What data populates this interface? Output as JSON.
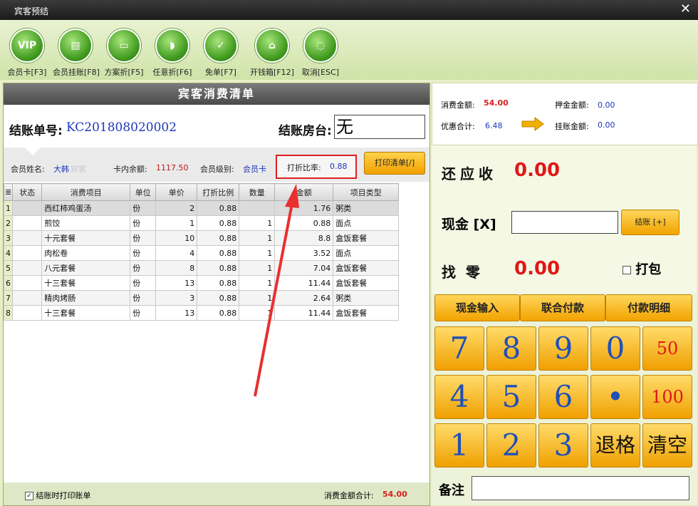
{
  "window": {
    "title": "宾客预结",
    "close": "✕"
  },
  "toolbar": [
    {
      "label": "会员卡[F3]",
      "icon": "vip-icon",
      "glyph": "VIP"
    },
    {
      "label": "会员挂账[F8]",
      "icon": "document-icon",
      "glyph": "▤"
    },
    {
      "label": "方案折[F5]",
      "icon": "window-icon",
      "glyph": "▭"
    },
    {
      "label": "任意折[F6]",
      "icon": "bottle-icon",
      "glyph": "◗"
    },
    {
      "label": "免单[F7]",
      "icon": "clipboard-check-icon",
      "glyph": "✓"
    },
    {
      "label": "开钱箱[F12]",
      "icon": "cashbox-icon",
      "glyph": "⌂"
    },
    {
      "label": "取消[ESC]",
      "icon": "cancel-ring-icon",
      "glyph": "◌"
    }
  ],
  "bill": {
    "title": "宾客消费清单",
    "order_label": "结账单号:",
    "order_no": "KC201808020002",
    "room_label": "结账房台:",
    "room_value": "无",
    "member_name_label": "会员姓名:",
    "member_name": "大韩",
    "member_name_faint": "宾客",
    "balance_label": "卡内余额:",
    "balance": "1117.50",
    "level_label": "会员级别:",
    "level": "会员卡",
    "rate_label": "打折比率:",
    "rate": "0.88",
    "print_button": "打印清单[/]"
  },
  "table": {
    "columns": [
      "≣",
      "状态",
      "消费项目",
      "单位",
      "单价",
      "打折比例",
      "数量",
      "金额",
      "项目类型"
    ],
    "rows": [
      [
        "1",
        "",
        "西红柿鸡蛋汤",
        "份",
        "2",
        "0.88",
        "",
        "1.76",
        "粥类"
      ],
      [
        "2",
        "",
        "煎饺",
        "份",
        "1",
        "0.88",
        "1",
        "0.88",
        "面点"
      ],
      [
        "3",
        "",
        "十元套餐",
        "份",
        "10",
        "0.88",
        "1",
        "8.8",
        "盒饭套餐"
      ],
      [
        "4",
        "",
        "肉松卷",
        "份",
        "4",
        "0.88",
        "1",
        "3.52",
        "面点"
      ],
      [
        "5",
        "",
        "八元套餐",
        "份",
        "8",
        "0.88",
        "1",
        "7.04",
        "盒饭套餐"
      ],
      [
        "6",
        "",
        "十三套餐",
        "份",
        "13",
        "0.88",
        "1",
        "11.44",
        "盒饭套餐"
      ],
      [
        "7",
        "",
        "精肉烤肠",
        "份",
        "3",
        "0.88",
        "1",
        "2.64",
        "粥类"
      ],
      [
        "8",
        "",
        "十三套餐",
        "份",
        "13",
        "0.88",
        "1",
        "11.44",
        "盒饭套餐"
      ]
    ]
  },
  "footer": {
    "print_on_checkout": "结账时打印账单",
    "checked": "✓",
    "total_label": "消费金额合计:",
    "total": "54.00"
  },
  "summary": {
    "consume_label": "消费金额:",
    "consume": "54.00",
    "deposit_label": "押金金额:",
    "deposit": "0.00",
    "discount_label": "优惠合计:",
    "discount": "6.48",
    "credit_label": "挂账金额:",
    "credit": "0.00"
  },
  "pay": {
    "due_label": "还应收",
    "due": "0.00",
    "cash_label": "现金 [X]",
    "cash_value": "",
    "checkout_button": "结账 [+]",
    "change_label": "找  零",
    "change": "0.00",
    "pack_label": "打包",
    "tabs": [
      "现金输入",
      "联合付款",
      "付款明细"
    ],
    "keys": [
      "7",
      "8",
      "9",
      "0",
      "50",
      "4",
      "5",
      "6",
      "•",
      "100",
      "1",
      "2",
      "3",
      "退格",
      "清空"
    ],
    "remark_label": "备注",
    "remark_value": ""
  },
  "colors": {
    "accent_red": "#e01818",
    "blue_text": "#1e36b8",
    "button_orange": "#f2a300",
    "panel_green": "#e8efc8"
  }
}
